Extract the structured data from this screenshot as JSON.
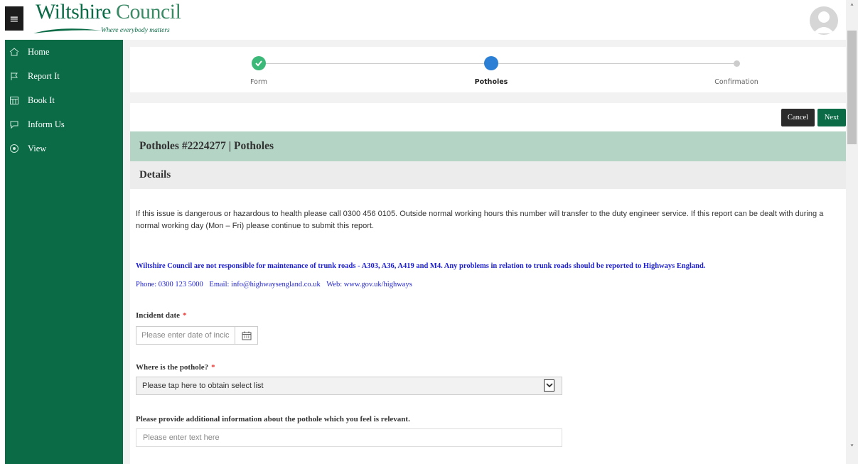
{
  "header": {
    "menu_glyph": "≡",
    "logo": {
      "word1": "Wiltshire",
      "word2": "Council",
      "tagline": "Where everybody matters"
    },
    "avatar_icon": "user-avatar-icon"
  },
  "sidebar": {
    "items": [
      {
        "label": "Home",
        "icon": "home-icon"
      },
      {
        "label": "Report It",
        "icon": "report-icon"
      },
      {
        "label": "Book It",
        "icon": "book-icon"
      },
      {
        "label": "Inform Us",
        "icon": "chat-icon"
      },
      {
        "label": "View",
        "icon": "eye-icon"
      }
    ]
  },
  "stepper": {
    "steps": [
      {
        "label": "Form",
        "state": "complete"
      },
      {
        "label": "Potholes",
        "state": "active"
      },
      {
        "label": "Confirmation",
        "state": "pending"
      }
    ]
  },
  "actions": {
    "cancel": "Cancel",
    "next": "Next"
  },
  "page": {
    "title": "Potholes #2224277 | Potholes",
    "section": "Details",
    "intro": "If this issue is dangerous or hazardous to health please call 0300 456 0105. Outside normal working hours this number will transfer to the duty engineer service.  If this report can be dealt with during a normal working day (Mon – Fri) please continue to submit this report.",
    "warning": "Wiltshire Council are not responsible for maintenance of trunk roads - A303, A36, A419 and M4.  Any problems in relation to trunk roads should be reported to Highways England.",
    "contact": {
      "phone": "Phone: 0300 123 5000",
      "email": "Email: info@highwaysengland.co.uk",
      "web": "Web: www.gov.uk/highways"
    }
  },
  "form": {
    "incident_date": {
      "label": "Incident date",
      "required": "*",
      "placeholder": "Please enter date of incic",
      "value": ""
    },
    "location": {
      "label": "Where is the pothole?",
      "required": "*",
      "selected": "Please tap here to obtain select list"
    },
    "additional": {
      "label": "Please provide additional information about the pothole which you feel is relevant.",
      "placeholder": "Please enter text here",
      "value": ""
    }
  },
  "colors": {
    "brand": "#0a6b46",
    "step_complete": "#3cb878",
    "step_active": "#2b7fd4",
    "step_pending": "#cccccc",
    "title_bar": "#b4d4c6",
    "warning_text": "#1d1fd0",
    "required": "#e53935"
  }
}
